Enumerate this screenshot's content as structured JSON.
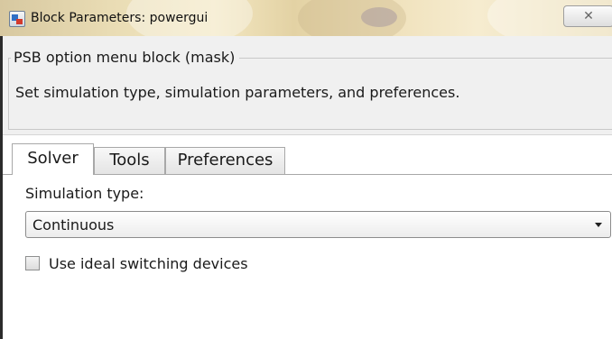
{
  "window": {
    "title": "Block Parameters: powergui",
    "close_glyph": "✕",
    "icon": "block-parameters-icon"
  },
  "header": {
    "group_title": "PSB option menu block (mask)",
    "description": "Set simulation type, simulation parameters, and preferences."
  },
  "tabs": [
    {
      "label": "Solver",
      "active": true
    },
    {
      "label": "Tools",
      "active": false
    },
    {
      "label": "Preferences",
      "active": false
    }
  ],
  "solver": {
    "simulation_type_label": "Simulation type:",
    "simulation_type_value": "Continuous",
    "ideal_switching_label": "Use ideal switching devices",
    "ideal_switching_checked": false
  },
  "colors": {
    "panel_background": "#f0f0f0",
    "titlebar_gradient_start": "#d7c8a0",
    "titlebar_gradient_end": "#eadcb4"
  }
}
